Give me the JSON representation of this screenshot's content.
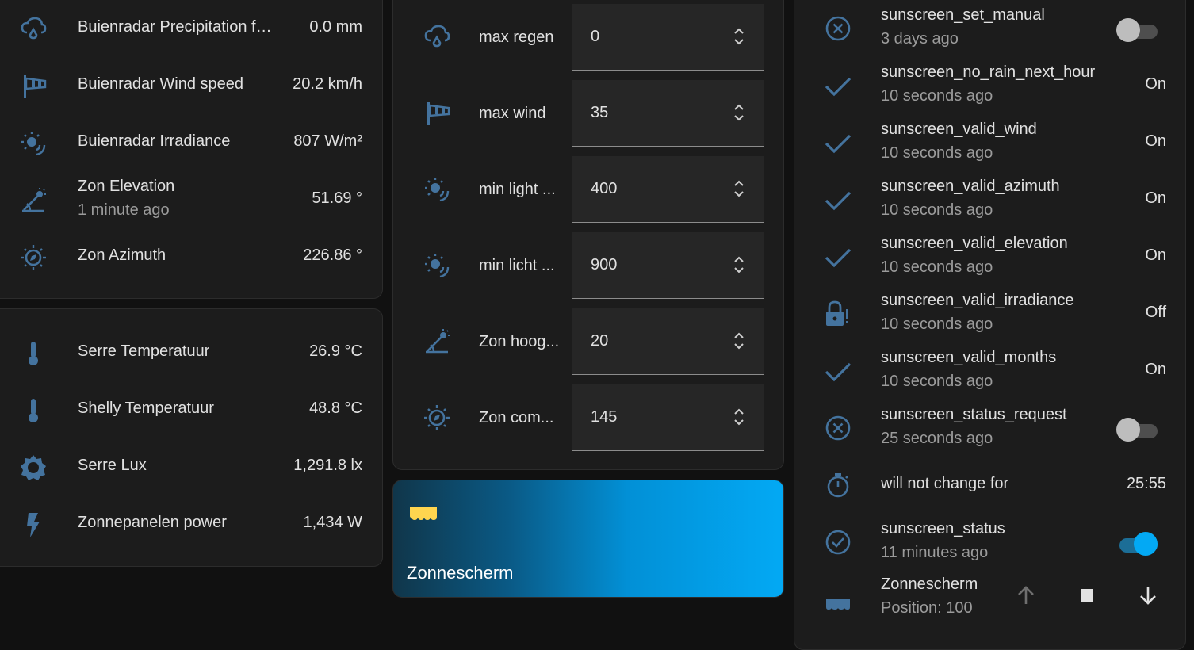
{
  "sensors_card": {
    "rows": [
      {
        "name": "Buienradar Precipitation for...",
        "value": "0.0 mm",
        "icon": "weather-pouring-icon"
      },
      {
        "name": "Buienradar Wind speed",
        "value": "20.2 km/h",
        "icon": "windsock-icon"
      },
      {
        "name": "Buienradar Irradiance",
        "value": "807 W/m²",
        "icon": "sun-wireless-icon"
      },
      {
        "name": "Zon Elevation",
        "secondary": "1 minute ago",
        "value": "51.69 °",
        "icon": "sun-angle-icon"
      },
      {
        "name": "Zon Azimuth",
        "value": "226.86 °",
        "icon": "sun-compass-icon"
      }
    ]
  },
  "greenhouse_card": {
    "rows": [
      {
        "name": "Serre Temperatuur",
        "value": "26.9 °C",
        "icon": "thermometer-icon"
      },
      {
        "name": "Shelly Temperatuur",
        "value": "48.8 °C",
        "icon": "thermometer-icon"
      },
      {
        "name": "Serre Lux",
        "value": "1,291.8 lx",
        "icon": "brightness-icon"
      },
      {
        "name": "Zonnepanelen power",
        "value": "1,434 W",
        "icon": "flash-icon"
      }
    ]
  },
  "settings_card": {
    "rows": [
      {
        "name": "max regen",
        "value": "0",
        "icon": "weather-pouring-icon"
      },
      {
        "name": "max wind",
        "value": "35",
        "icon": "windsock-icon"
      },
      {
        "name": "min light ...",
        "value": "400",
        "icon": "sun-wireless-icon"
      },
      {
        "name": "min licht ...",
        "value": "900",
        "icon": "sun-wireless-icon"
      },
      {
        "name": "Zon hoog...",
        "value": "20",
        "icon": "sun-angle-icon"
      },
      {
        "name": "Zon com...",
        "value": "145",
        "icon": "sun-compass-icon"
      }
    ]
  },
  "tile": {
    "name": "Zonnescherm",
    "icon": "awning-icon",
    "colors": {
      "from": "#10364a",
      "to": "#03a9f4",
      "icon": "#ffd54f"
    }
  },
  "status_card": {
    "rows": [
      {
        "name": "sunscreen_set_manual",
        "secondary": "3 days ago",
        "control": "toggle",
        "state": "off",
        "icon": "close-circle-icon"
      },
      {
        "name": "sunscreen_no_rain_next_hour",
        "secondary": "10 seconds ago",
        "value": "On",
        "icon": "check-icon"
      },
      {
        "name": "sunscreen_valid_wind",
        "secondary": "10 seconds ago",
        "value": "On",
        "icon": "check-icon"
      },
      {
        "name": "sunscreen_valid_azimuth",
        "secondary": "10 seconds ago",
        "value": "On",
        "icon": "check-icon"
      },
      {
        "name": "sunscreen_valid_elevation",
        "secondary": "10 seconds ago",
        "value": "On",
        "icon": "check-icon"
      },
      {
        "name": "sunscreen_valid_irradiance",
        "secondary": "10 seconds ago",
        "value": "Off",
        "icon": "lock-alert-icon"
      },
      {
        "name": "sunscreen_valid_months",
        "secondary": "10 seconds ago",
        "value": "On",
        "icon": "check-icon"
      },
      {
        "name": "sunscreen_status_request",
        "secondary": "25 seconds ago",
        "control": "toggle",
        "state": "off",
        "icon": "close-circle-icon"
      },
      {
        "name": "will not change for",
        "value": "25:55",
        "icon": "timer-icon"
      },
      {
        "name": "sunscreen_status",
        "secondary": "11 minutes ago",
        "control": "toggle",
        "state": "on",
        "icon": "check-circle-icon"
      },
      {
        "name": "Zonnescherm",
        "secondary": "Position: 100",
        "control": "cover",
        "icon": "awning-icon"
      }
    ]
  },
  "colors": {
    "icon": "#44739e",
    "background": "#111111",
    "card": "#1c1c1c",
    "accent": "#03a9f4",
    "text": "#e1e1e1",
    "secondary_text": "#9b9b9b"
  }
}
